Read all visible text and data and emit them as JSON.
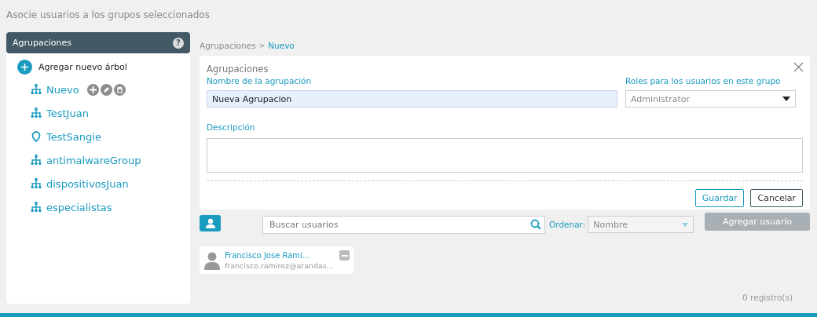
{
  "page_title": "Asocie usuarios a los grupos seleccionados",
  "sidebar": {
    "title": "Agrupaciones",
    "help": "?",
    "add_label": "Agregar nuevo árbol",
    "items": [
      {
        "label": "Nuevo",
        "kind": "tree",
        "selected": true
      },
      {
        "label": "TestJuan",
        "kind": "tree",
        "selected": false
      },
      {
        "label": "TestSangie",
        "kind": "location",
        "selected": false
      },
      {
        "label": "antimalwareGroup",
        "kind": "tree",
        "selected": false
      },
      {
        "label": "dispositivosJuan",
        "kind": "tree",
        "selected": false
      },
      {
        "label": "especialistas",
        "kind": "tree",
        "selected": false
      }
    ]
  },
  "breadcrumb": [
    {
      "label": "Agrupaciones",
      "selected": false
    },
    {
      "label": "Nuevo",
      "selected": true
    }
  ],
  "breadcrumb_separator": ">",
  "form": {
    "title": "Agrupaciones",
    "name_label": "Nombre de la agrupación",
    "name_value": "Nueva Agrupacion",
    "roles_label": "Roles para los usuarios en este grupo",
    "roles_value": "Administrator",
    "description_label": "Descripción",
    "buttons": [
      {
        "label": "Guardar",
        "kind": "primary"
      },
      {
        "label": "Cancelar",
        "kind": "secondary"
      }
    ]
  },
  "users": {
    "search_placeholder": "Buscar usuarios",
    "sort_label": "Ordenar:",
    "sort_value": "Nombre",
    "add_button": "Agregar usuario",
    "add_disabled": true,
    "list": [
      {
        "name": "Francisco Jose Rami...",
        "email": "francisco.ramirez@arandas..."
      }
    ],
    "count": "0 registro(s)"
  }
}
